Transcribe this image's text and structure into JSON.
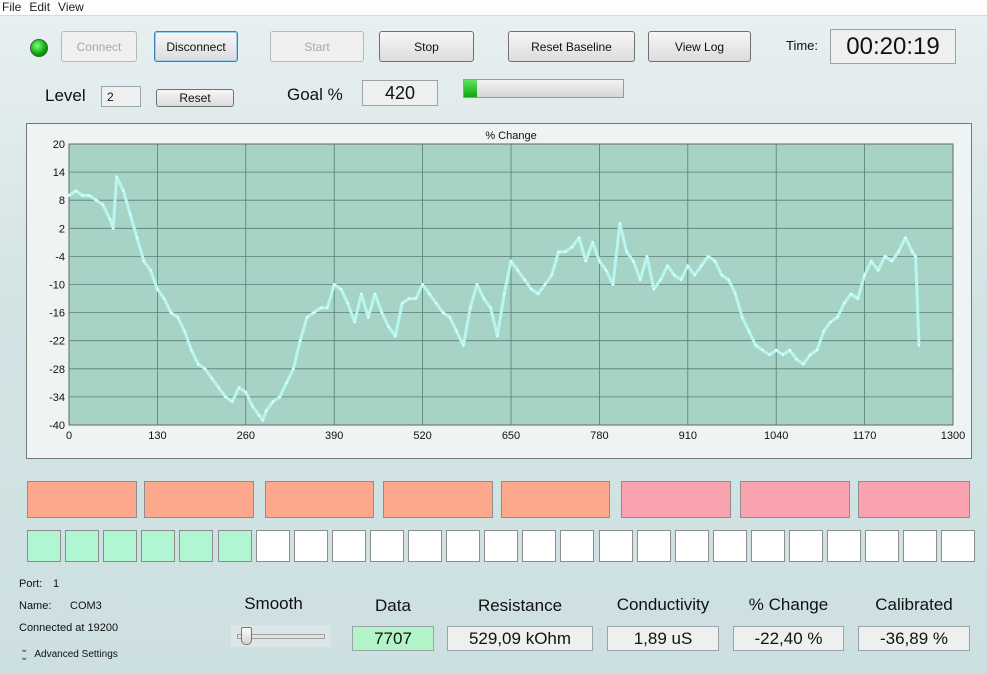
{
  "menu": {
    "items": [
      "File",
      "Edit",
      "View"
    ]
  },
  "toolbar": {
    "connect_label": "Connect",
    "disconnect_label": "Disconnect",
    "start_label": "Start",
    "stop_label": "Stop",
    "reset_baseline_label": "Reset Baseline",
    "view_log_label": "View Log",
    "time_label": "Time:",
    "time_value": "00:20:19"
  },
  "level": {
    "label": "Level",
    "value": "2",
    "reset_label": "Reset"
  },
  "goal": {
    "label": "Goal %",
    "value": "420",
    "progress": 0.08
  },
  "chart_data": {
    "type": "line",
    "title": "% Change",
    "xlim": [
      0,
      1300
    ],
    "ylim": [
      -40,
      20
    ],
    "x_ticks": [
      0,
      130,
      260,
      390,
      520,
      650,
      780,
      910,
      1040,
      1170,
      1300
    ],
    "y_ticks": [
      20,
      14,
      8,
      2,
      -4,
      -10,
      -16,
      -22,
      -28,
      -34,
      -40
    ],
    "grid": true,
    "series": [
      {
        "color": "#b8f6f0",
        "x": [
          0,
          10,
          20,
          30,
          40,
          50,
          60,
          65,
          70,
          80,
          90,
          100,
          110,
          120,
          130,
          140,
          150,
          160,
          170,
          180,
          190,
          200,
          210,
          220,
          230,
          240,
          250,
          260,
          270,
          280,
          285,
          290,
          300,
          310,
          320,
          330,
          340,
          350,
          360,
          370,
          380,
          390,
          400,
          410,
          420,
          430,
          440,
          450,
          460,
          470,
          480,
          490,
          500,
          510,
          520,
          530,
          540,
          550,
          560,
          570,
          580,
          590,
          600,
          610,
          620,
          630,
          640,
          650,
          660,
          670,
          680,
          690,
          700,
          710,
          720,
          730,
          740,
          750,
          760,
          770,
          780,
          790,
          800,
          810,
          820,
          830,
          840,
          850,
          860,
          870,
          880,
          890,
          900,
          910,
          920,
          930,
          940,
          950,
          960,
          970,
          980,
          990,
          1000,
          1010,
          1020,
          1030,
          1040,
          1050,
          1060,
          1070,
          1080,
          1090,
          1100,
          1110,
          1120,
          1130,
          1140,
          1150,
          1160,
          1170,
          1180,
          1190,
          1200,
          1210,
          1220,
          1230,
          1240,
          1245,
          1250
        ],
        "y": [
          9,
          10,
          9,
          9,
          8,
          7,
          4,
          2,
          13,
          10,
          5,
          0,
          -5,
          -7,
          -11,
          -13,
          -16,
          -17,
          -20,
          -24,
          -27,
          -28,
          -30,
          -32,
          -34,
          -35,
          -32,
          -33,
          -36,
          -38,
          -39,
          -37,
          -35,
          -34,
          -31,
          -28,
          -22,
          -17,
          -16,
          -15,
          -15,
          -10,
          -11,
          -14,
          -18,
          -12,
          -17,
          -12,
          -16,
          -19,
          -21,
          -14,
          -13,
          -13,
          -10,
          -12,
          -14,
          -16,
          -17,
          -20,
          -23,
          -15,
          -10,
          -13,
          -15,
          -21,
          -12,
          -5,
          -7,
          -9,
          -11,
          -12,
          -10,
          -8,
          -3,
          -3,
          -2,
          0,
          -5,
          -1,
          -5,
          -7,
          -10,
          3,
          -3,
          -5,
          -9,
          -4,
          -11,
          -9,
          -6,
          -8,
          -9,
          -6,
          -8,
          -6,
          -4,
          -5,
          -8,
          -9,
          -12,
          -17,
          -20,
          -23,
          -24,
          -25,
          -24,
          -25,
          -24,
          -26,
          -27,
          -25,
          -24,
          -20,
          -18,
          -17,
          -14,
          -12,
          -13,
          -8,
          -5,
          -7,
          -4,
          -5,
          -3,
          0,
          -3,
          -4,
          -23
        ]
      }
    ]
  },
  "indicators": {
    "top": [
      {
        "color": "#fba88c"
      },
      {
        "color": "#fba88c"
      },
      {
        "color": "#fba88c"
      },
      {
        "color": "#fba88c"
      },
      {
        "color": "#fba88c"
      },
      {
        "color": "#f9a3b0"
      },
      {
        "color": "#f9a3b0"
      },
      {
        "color": "#f9a3b0"
      }
    ],
    "bottom_active": 6,
    "bottom_count": 25,
    "active_color": "#b0f6d2",
    "inactive_color": "#ffffff"
  },
  "connection": {
    "port_label": "Port:",
    "port_value": "1",
    "name_label": "Name:",
    "name_value": "COM3",
    "status": "Connected at 19200",
    "advanced_label": "Advanced Settings"
  },
  "smooth": {
    "label": "Smooth",
    "value": 0.05
  },
  "readouts": {
    "data": {
      "label": "Data",
      "value": "7707"
    },
    "resistance": {
      "label": "Resistance",
      "value": "529,09 kOhm"
    },
    "conductivity": {
      "label": "Conductivity",
      "value": "1,89 uS"
    },
    "pct_change": {
      "label": "% Change",
      "value": "-22,40 %"
    },
    "calibrated": {
      "label": "Calibrated",
      "value": "-36,89 %"
    }
  }
}
